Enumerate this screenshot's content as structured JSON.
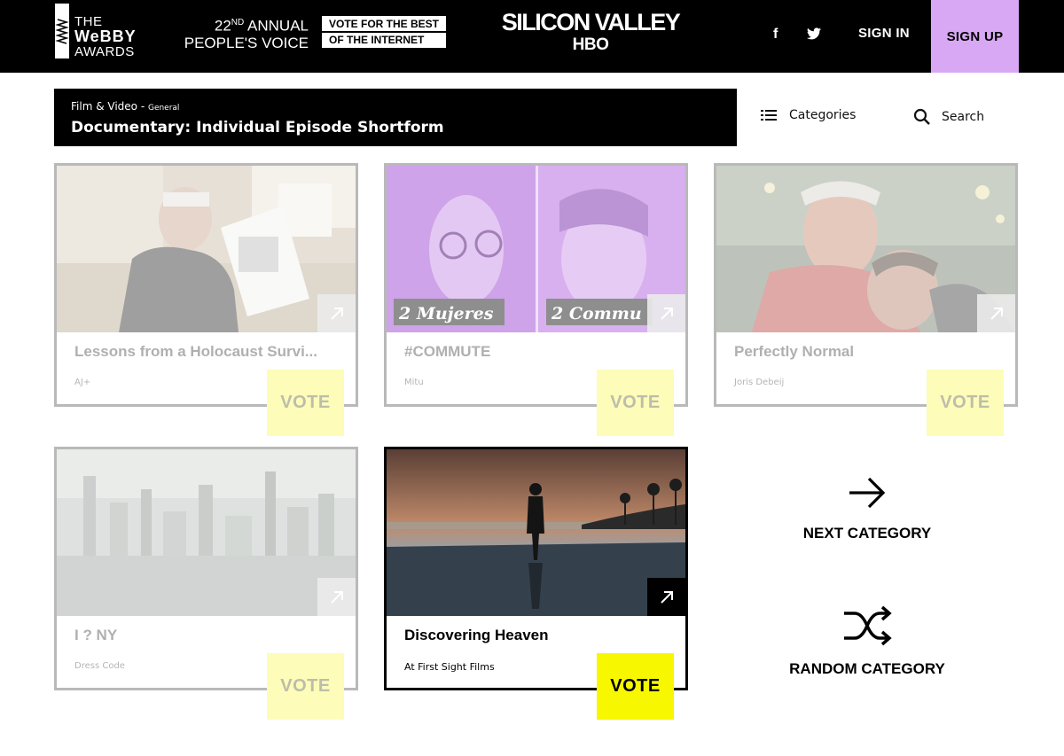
{
  "header": {
    "logo_lines": [
      "THE",
      "WeBBY",
      "AWARDS"
    ],
    "annual_ordinal": "22",
    "annual_suffix": "ND",
    "annual_rest": " ANNUAL",
    "peoples_voice": "PEOPLE'S VOICE",
    "vote_best_lines": [
      "VOTE FOR THE BEST",
      "OF THE INTERNET"
    ],
    "sponsor_title": "SILICON VALLEY",
    "sponsor_network": "HBO",
    "facebook": "f",
    "sign_in": "SIGN IN",
    "sign_up": "SIGN UP"
  },
  "category": {
    "parent": "Film & Video",
    "subgroup": "General",
    "name": "Documentary: Individual Episode Shortform"
  },
  "tools": {
    "categories_label": "Categories",
    "search_label": "Search"
  },
  "entries": [
    {
      "title": "Lessons from a Holocaust Survi...",
      "org": "AJ+",
      "vote_label": "VOTE"
    },
    {
      "title": "#COMMUTE",
      "org": "Mitu",
      "vote_label": "VOTE",
      "thumb_text": [
        "2 Mujeres",
        "2 Commu"
      ]
    },
    {
      "title": "Perfectly Normal",
      "org": "Joris Debeij",
      "vote_label": "VOTE"
    },
    {
      "title": "I ? NY",
      "org": "Dress Code",
      "vote_label": "VOTE"
    },
    {
      "title": "Discovering Heaven",
      "org": "At First Sight Films",
      "vote_label": "VOTE"
    }
  ],
  "nav": {
    "next": "NEXT CATEGORY",
    "random": "RANDOM CATEGORY"
  },
  "colors": {
    "signup_bg": "#d9a8f5",
    "vote_active": "#f7f700",
    "vote_faded": "#fdfcb9"
  }
}
